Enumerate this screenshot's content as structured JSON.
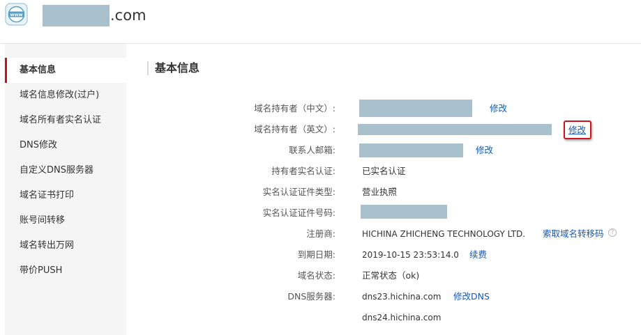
{
  "header": {
    "domain_suffix": ".com",
    "logo_text": "www"
  },
  "sidebar": {
    "items": [
      {
        "label": "基本信息",
        "active": true
      },
      {
        "label": "域名信息修改(过户)"
      },
      {
        "label": "域名所有者实名认证"
      },
      {
        "label": "DNS修改"
      },
      {
        "label": "自定义DNS服务器"
      },
      {
        "label": "域名证书打印"
      },
      {
        "label": "账号间转移"
      },
      {
        "label": "域名转出万网"
      },
      {
        "label": "带价PUSH"
      }
    ]
  },
  "main": {
    "title": "基本信息",
    "rows": {
      "owner_cn": {
        "label": "域名持有者（中文）:",
        "action": "修改"
      },
      "owner_en": {
        "label": "域名持有者（英文）:",
        "action": "修改"
      },
      "email": {
        "label": "联系人邮箱:",
        "action": "修改"
      },
      "verification": {
        "label": "持有者实名认证:",
        "value": "已实名认证"
      },
      "cert_type": {
        "label": "实名认证证件类型:",
        "value": "营业执照"
      },
      "cert_number": {
        "label": "实名认证证件号码:"
      },
      "registrar": {
        "label": "注册商:",
        "value": "HICHINA ZHICHENG TECHNOLOGY LTD.",
        "action": "索取域名转移码"
      },
      "expiry": {
        "label": "到期日期:",
        "value": "2019-10-15 23:53:14.0",
        "action": "续费"
      },
      "status": {
        "label": "域名状态:",
        "value": "正常状态（ok)"
      },
      "dns": {
        "label": "DNS服务器:",
        "values": [
          "dns23.hichina.com",
          "dns24.hichina.com"
        ],
        "action": "修改DNS"
      }
    }
  },
  "colors": {
    "accent_red": "#c3141c",
    "link_blue": "#1658b3",
    "mask": "#a8c1cd"
  }
}
